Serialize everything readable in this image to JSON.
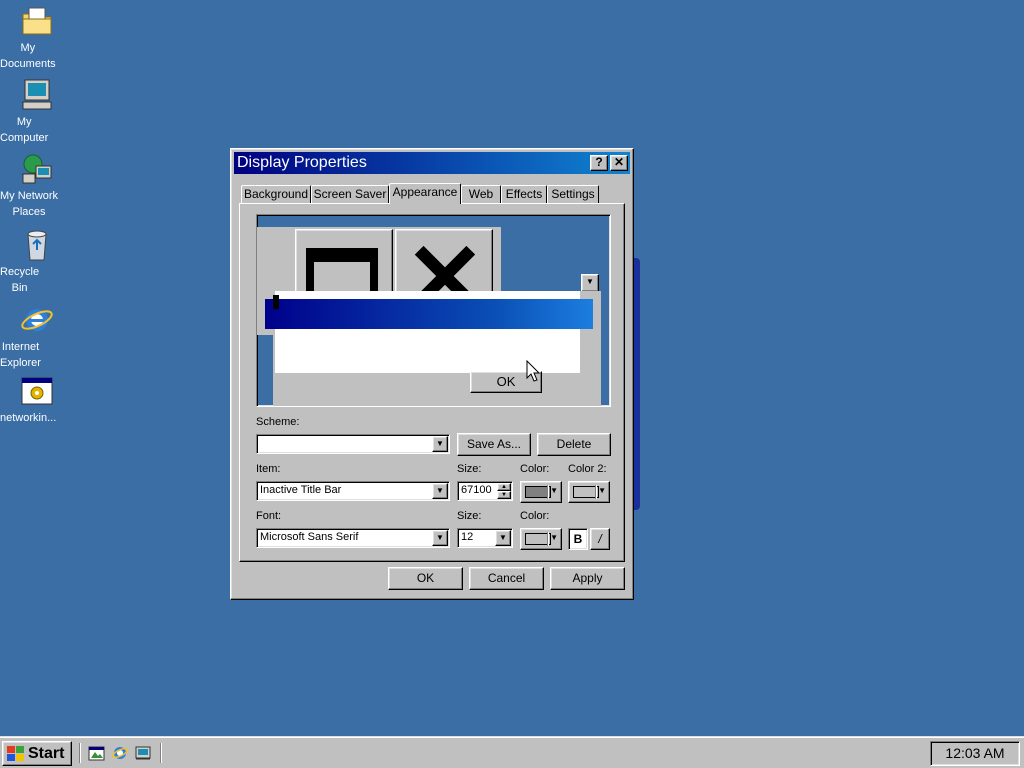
{
  "desktop": {
    "icons": [
      {
        "label": "My\nDocuments",
        "icon": "my-documents-icon"
      },
      {
        "label": "My\nComputer",
        "icon": "my-computer-icon"
      },
      {
        "label": "My Network\nPlaces",
        "icon": "network-places-icon"
      },
      {
        "label": "Recycle\nBin",
        "icon": "recycle-bin-icon"
      },
      {
        "label": "Internet\nExplorer",
        "icon": "internet-explorer-icon"
      },
      {
        "label": "networkin...",
        "icon": "program-window-icon"
      }
    ]
  },
  "dialog": {
    "title": "Display Properties",
    "help_glyph": "?",
    "close_glyph": "✕",
    "tabs": [
      {
        "label": "Background"
      },
      {
        "label": "Screen Saver"
      },
      {
        "label": "Appearance",
        "active": true
      },
      {
        "label": "Web"
      },
      {
        "label": "Effects"
      },
      {
        "label": "Settings"
      }
    ],
    "preview": {
      "ok_label": "OK"
    },
    "scheme": {
      "label": "Scheme:",
      "value": "",
      "save_as_label": "Save As...",
      "delete_label": "Delete"
    },
    "item": {
      "label": "Item:",
      "value": "Inactive Title Bar",
      "size_label": "Size:",
      "size_value": "67100",
      "color_label": "Color:",
      "color_value": "#808080",
      "color2_label": "Color 2:",
      "color2_value": "#c0c0c0"
    },
    "font": {
      "label": "Font:",
      "value": "Microsoft Sans Serif",
      "size_label": "Size:",
      "size_value": "12",
      "color_label": "Color:",
      "color_value": "#c0c0c0",
      "bold_label": "B",
      "italic_label": "/"
    },
    "buttons": {
      "ok": "OK",
      "cancel": "Cancel",
      "apply": "Apply"
    }
  },
  "taskbar": {
    "start_label": "Start",
    "quick_launch": [
      "show-desktop-icon",
      "internet-explorer-icon",
      "channels-icon"
    ],
    "clock": "12:03 AM"
  },
  "colors": {
    "desktop": "#3a6ea5",
    "title_active_start": "#000080",
    "title_active_end": "#1084d0",
    "face": "#c0c0c0"
  }
}
